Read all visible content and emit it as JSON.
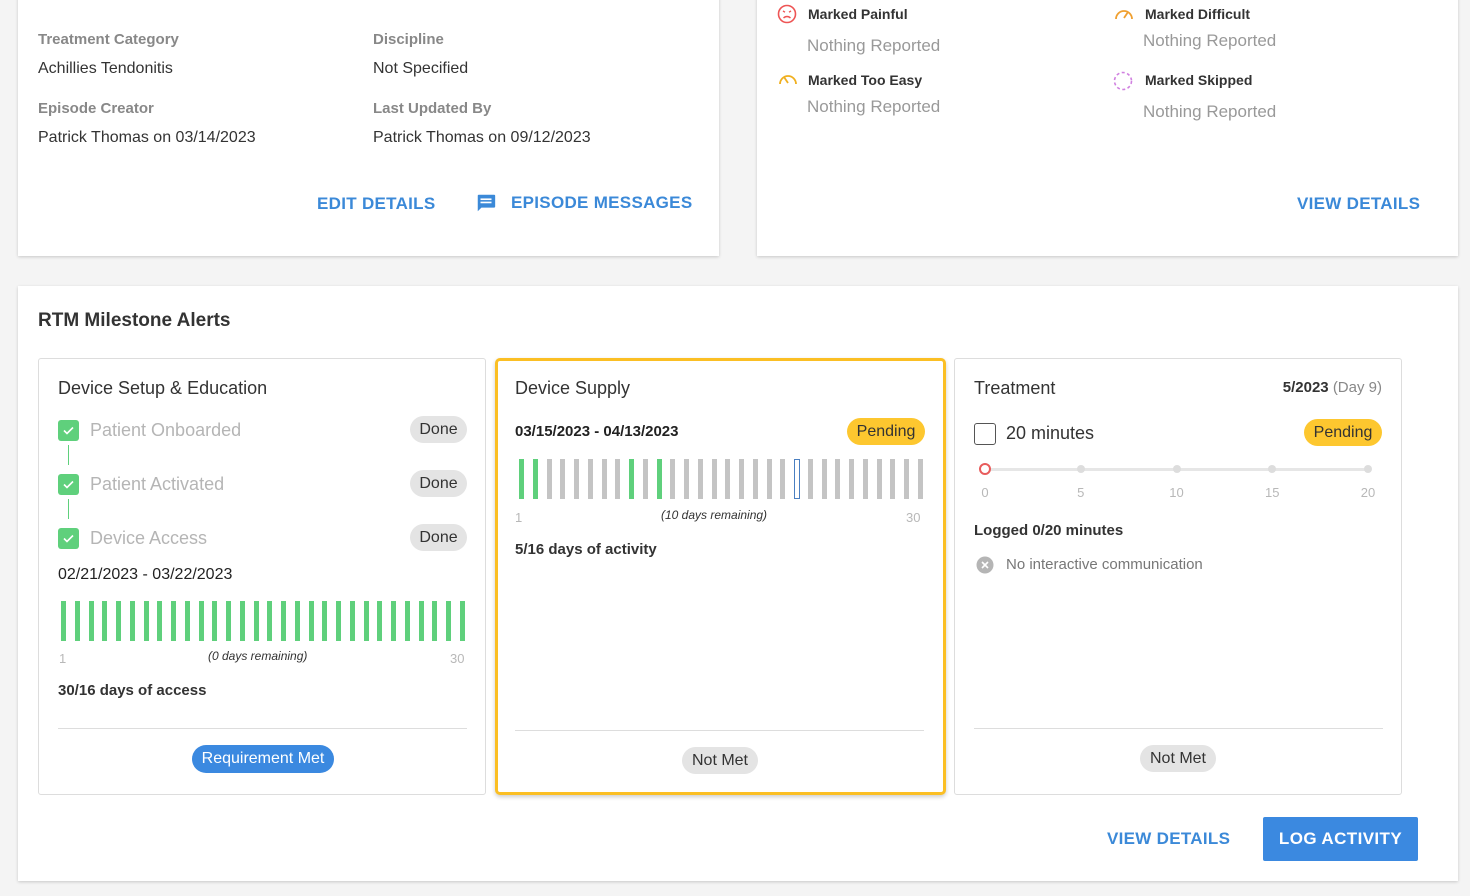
{
  "details": {
    "treatment_category_label": "Treatment Category",
    "treatment_category_value": "Achillies Tendonitis",
    "discipline_label": "Discipline",
    "discipline_value": "Not Specified",
    "episode_creator_label": "Episode Creator",
    "episode_creator_value": "Patrick Thomas on 03/14/2023",
    "last_updated_label": "Last Updated By",
    "last_updated_value": "Patrick Thomas on 09/12/2023",
    "edit_details_label": "EDIT DETAILS",
    "episode_messages_label": "EPISODE MESSAGES"
  },
  "feedback": {
    "painful_label": "Marked Painful",
    "painful_value": "Nothing Reported",
    "difficult_label": "Marked Difficult",
    "difficult_value": "Nothing Reported",
    "too_easy_label": "Marked Too Easy",
    "too_easy_value": "Nothing Reported",
    "skipped_label": "Marked Skipped",
    "skipped_value": "Nothing Reported",
    "view_details_label": "VIEW DETAILS"
  },
  "rtm": {
    "title": "RTM Milestone Alerts",
    "setup": {
      "title": "Device Setup & Education",
      "steps": [
        {
          "label": "Patient Onboarded",
          "status": "Done"
        },
        {
          "label": "Patient Activated",
          "status": "Done"
        },
        {
          "label": "Device Access",
          "status": "Done"
        }
      ],
      "date_range": "02/21/2023 - 03/22/2023",
      "axis_start": "1",
      "axis_end": "30",
      "remaining": "(0 days remaining)",
      "summary": "30/16 days of access",
      "badge": "Requirement Met",
      "day_states": [
        "g",
        "g",
        "g",
        "g",
        "g",
        "g",
        "g",
        "g",
        "g",
        "g",
        "g",
        "g",
        "g",
        "g",
        "g",
        "g",
        "g",
        "g",
        "g",
        "g",
        "g",
        "g",
        "g",
        "g",
        "g",
        "g",
        "g",
        "g",
        "g",
        "g"
      ]
    },
    "supply": {
      "title": "Device Supply",
      "date_range": "03/15/2023 - 04/13/2023",
      "status": "Pending",
      "axis_start": "1",
      "axis_end": "30",
      "remaining": "(10 days remaining)",
      "summary": "5/16 days of activity",
      "badge": "Not Met",
      "day_states": [
        "g",
        "g",
        "n",
        "n",
        "n",
        "n",
        "n",
        "n",
        "g",
        "n",
        "g",
        "n",
        "n",
        "n",
        "n",
        "n",
        "n",
        "n",
        "n",
        "n",
        "t",
        "n",
        "n",
        "n",
        "n",
        "n",
        "n",
        "n",
        "n",
        "n"
      ]
    },
    "treatment": {
      "title": "Treatment",
      "period": "5/2023",
      "day": "(Day 9)",
      "minutes_label": "20 minutes",
      "status": "Pending",
      "ticks": [
        "0",
        "5",
        "10",
        "15",
        "20"
      ],
      "logged_minutes": 0,
      "logged": "Logged 0/20 minutes",
      "interactive": "No interactive communication",
      "badge": "Not Met"
    },
    "view_details_label": "VIEW DETAILS",
    "log_activity_label": "LOG ACTIVITY"
  },
  "colors": {
    "accent": "#3b89e0",
    "done_green": "#5fd07c",
    "pending_yellow": "#fdc72f",
    "inactive_grey": "#c4c4c4",
    "today_blue": "#4a7fc1"
  }
}
